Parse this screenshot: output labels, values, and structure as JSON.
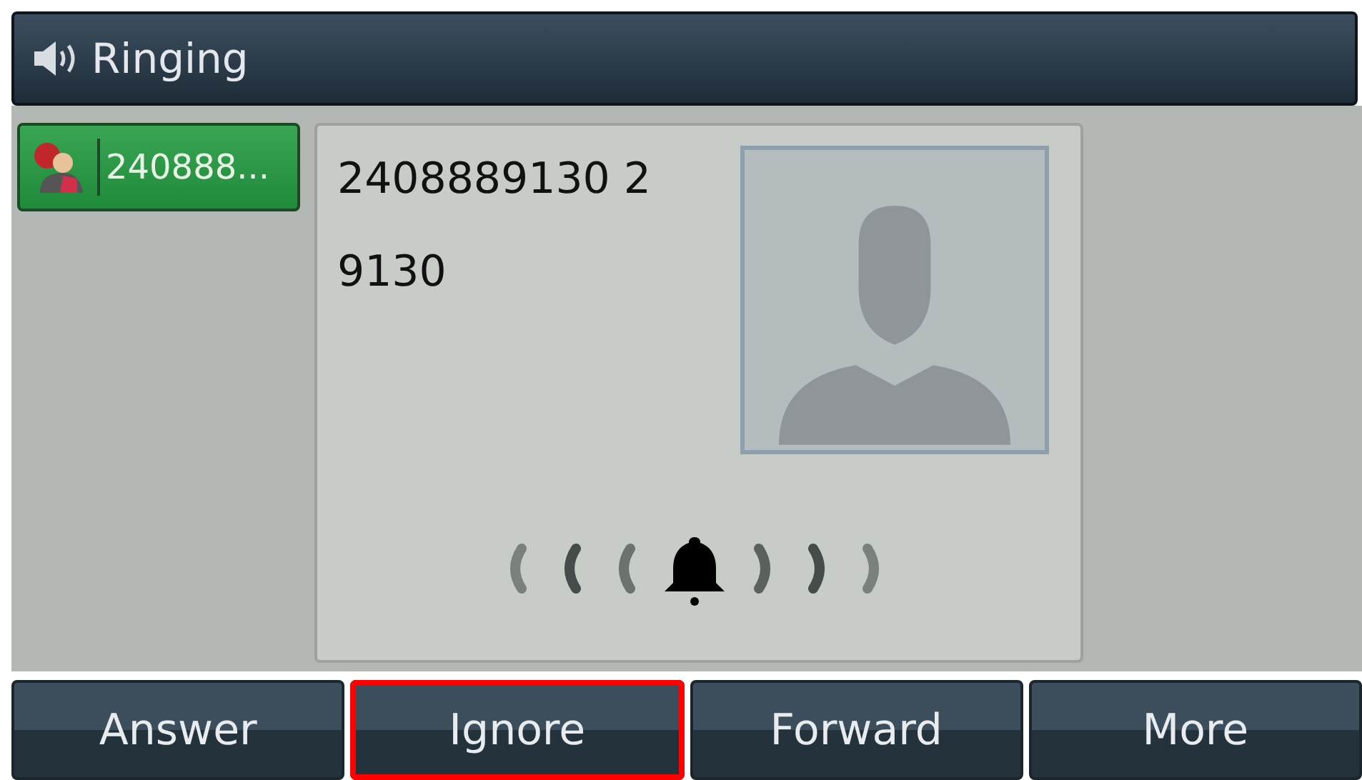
{
  "title_bar": {
    "title": "Ringing"
  },
  "call_tabs": [
    {
      "label": "240888...",
      "selected": true
    }
  ],
  "caller": {
    "name": "2408889130 2",
    "number": "9130"
  },
  "softkeys": [
    {
      "label": "Answer",
      "highlighted": false
    },
    {
      "label": "Ignore",
      "highlighted": true
    },
    {
      "label": "Forward",
      "highlighted": false
    },
    {
      "label": "More",
      "highlighted": false
    }
  ]
}
